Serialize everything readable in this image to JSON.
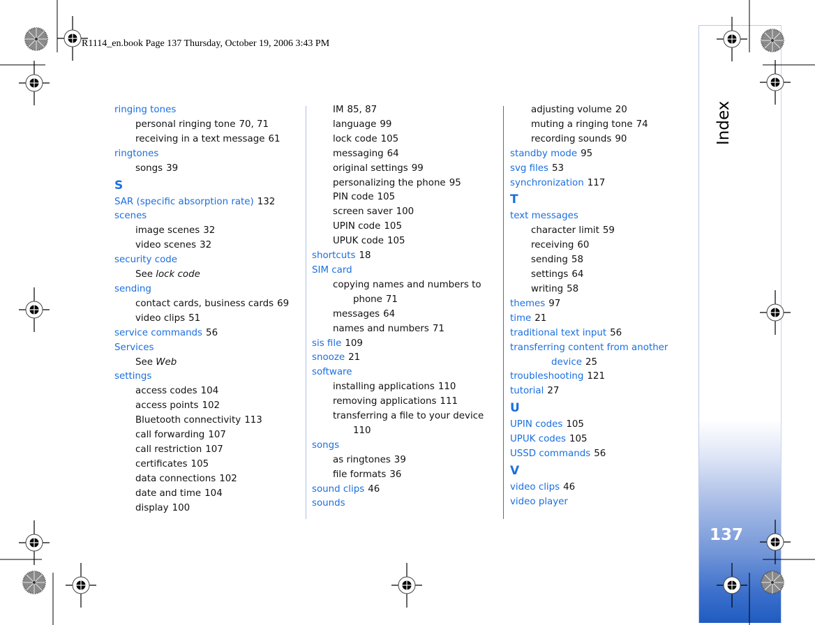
{
  "print_header": "R1114_en.book  Page 137  Thursday, October 19, 2006  3:43 PM",
  "sidebar": {
    "section_title": "Index",
    "page_number": "137"
  },
  "colors": {
    "term": "#1a6fe0",
    "text": "#111111",
    "sidebar_gradient_end": "#1f5cc0"
  },
  "columns": [
    {
      "entries": [
        {
          "type": "term",
          "text": "ringing tones",
          "page": ""
        },
        {
          "type": "sub",
          "text": "personal ringing tone",
          "page": "70, 71"
        },
        {
          "type": "sub",
          "text": "receiving in a text message",
          "page": "61"
        },
        {
          "type": "term",
          "text": "ringtones",
          "page": ""
        },
        {
          "type": "sub",
          "text": "songs",
          "page": "39"
        },
        {
          "type": "letter",
          "text": "S"
        },
        {
          "type": "term",
          "text": "SAR (specific absorption rate)",
          "page": "132"
        },
        {
          "type": "term",
          "text": "scenes",
          "page": ""
        },
        {
          "type": "sub",
          "text": "image scenes",
          "page": "32"
        },
        {
          "type": "sub",
          "text": "video scenes",
          "page": "32"
        },
        {
          "type": "term",
          "text": "security code",
          "page": ""
        },
        {
          "type": "see",
          "text": "See ",
          "ref": "lock code"
        },
        {
          "type": "term",
          "text": "sending",
          "page": ""
        },
        {
          "type": "sub",
          "text": "contact cards, business cards",
          "page": "69"
        },
        {
          "type": "sub",
          "text": "video clips",
          "page": "51"
        },
        {
          "type": "term",
          "text": "service commands",
          "page": "56"
        },
        {
          "type": "term",
          "text": "Services",
          "page": ""
        },
        {
          "type": "see",
          "text": "See ",
          "ref": "Web"
        },
        {
          "type": "term",
          "text": "settings",
          "page": ""
        },
        {
          "type": "sub",
          "text": "access codes",
          "page": "104"
        },
        {
          "type": "sub",
          "text": "access points",
          "page": "102"
        },
        {
          "type": "sub",
          "text": "Bluetooth connectivity",
          "page": "113"
        },
        {
          "type": "sub",
          "text": "call forwarding",
          "page": "107"
        },
        {
          "type": "sub",
          "text": "call restriction",
          "page": "107"
        },
        {
          "type": "sub",
          "text": "certificates",
          "page": "105"
        },
        {
          "type": "sub",
          "text": "data connections",
          "page": "102"
        },
        {
          "type": "sub",
          "text": "date and time",
          "page": "104"
        },
        {
          "type": "sub",
          "text": "display",
          "page": "100"
        }
      ]
    },
    {
      "entries": [
        {
          "type": "sub",
          "text": "IM",
          "page": "85, 87"
        },
        {
          "type": "sub",
          "text": "language",
          "page": "99"
        },
        {
          "type": "sub",
          "text": "lock code",
          "page": "105"
        },
        {
          "type": "sub",
          "text": "messaging",
          "page": "64"
        },
        {
          "type": "sub",
          "text": "original settings",
          "page": "99"
        },
        {
          "type": "sub",
          "text": "personalizing the phone",
          "page": "95"
        },
        {
          "type": "sub",
          "text": "PIN code",
          "page": "105"
        },
        {
          "type": "sub",
          "text": "screen saver",
          "page": "100"
        },
        {
          "type": "sub",
          "text": "UPIN code",
          "page": "105"
        },
        {
          "type": "sub",
          "text": "UPUK code",
          "page": "105"
        },
        {
          "type": "term",
          "text": "shortcuts",
          "page": "18"
        },
        {
          "type": "term",
          "text": "SIM card",
          "page": ""
        },
        {
          "type": "sub",
          "text": "copying names and numbers to",
          "page": ""
        },
        {
          "type": "cont",
          "text": "phone",
          "page": "71"
        },
        {
          "type": "sub",
          "text": "messages",
          "page": "64"
        },
        {
          "type": "sub",
          "text": "names and numbers",
          "page": "71"
        },
        {
          "type": "term",
          "text": "sis file",
          "page": "109"
        },
        {
          "type": "term",
          "text": "snooze",
          "page": "21"
        },
        {
          "type": "term",
          "text": "software",
          "page": ""
        },
        {
          "type": "sub",
          "text": "installing applications",
          "page": "110"
        },
        {
          "type": "sub",
          "text": "removing applications",
          "page": "111"
        },
        {
          "type": "sub",
          "text": "transferring a file to your device",
          "page": ""
        },
        {
          "type": "cont",
          "text": "",
          "page": "110"
        },
        {
          "type": "term",
          "text": "songs",
          "page": ""
        },
        {
          "type": "sub",
          "text": "as ringtones",
          "page": "39"
        },
        {
          "type": "sub",
          "text": "file formats",
          "page": "36"
        },
        {
          "type": "term",
          "text": "sound clips",
          "page": "46"
        },
        {
          "type": "term",
          "text": "sounds",
          "page": ""
        }
      ]
    },
    {
      "entries": [
        {
          "type": "sub",
          "text": "adjusting volume",
          "page": "20"
        },
        {
          "type": "sub",
          "text": "muting a ringing tone",
          "page": "74"
        },
        {
          "type": "sub",
          "text": "recording sounds",
          "page": "90"
        },
        {
          "type": "term",
          "text": "standby mode",
          "page": "95"
        },
        {
          "type": "term",
          "text": "svg files",
          "page": "53"
        },
        {
          "type": "term",
          "text": "synchronization",
          "page": "117"
        },
        {
          "type": "letter",
          "text": "T"
        },
        {
          "type": "term",
          "text": "text messages",
          "page": ""
        },
        {
          "type": "sub",
          "text": "character limit",
          "page": "59"
        },
        {
          "type": "sub",
          "text": "receiving",
          "page": "60"
        },
        {
          "type": "sub",
          "text": "sending",
          "page": "58"
        },
        {
          "type": "sub",
          "text": "settings",
          "page": "64"
        },
        {
          "type": "sub",
          "text": "writing",
          "page": "58"
        },
        {
          "type": "term",
          "text": "themes",
          "page": "97"
        },
        {
          "type": "term",
          "text": "time",
          "page": "21"
        },
        {
          "type": "term",
          "text": "traditional text input",
          "page": "56"
        },
        {
          "type": "term",
          "text": "transferring content from another",
          "page": ""
        },
        {
          "type": "termcont",
          "text": "device",
          "page": "25"
        },
        {
          "type": "term",
          "text": "troubleshooting",
          "page": "121"
        },
        {
          "type": "term",
          "text": "tutorial",
          "page": "27"
        },
        {
          "type": "letter",
          "text": "U"
        },
        {
          "type": "term",
          "text": "UPIN codes",
          "page": "105"
        },
        {
          "type": "term",
          "text": "UPUK codes",
          "page": "105"
        },
        {
          "type": "term",
          "text": "USSD commands",
          "page": "56"
        },
        {
          "type": "letter",
          "text": "V"
        },
        {
          "type": "term",
          "text": "video clips",
          "page": "46"
        },
        {
          "type": "term",
          "text": "video player",
          "page": ""
        }
      ]
    }
  ]
}
